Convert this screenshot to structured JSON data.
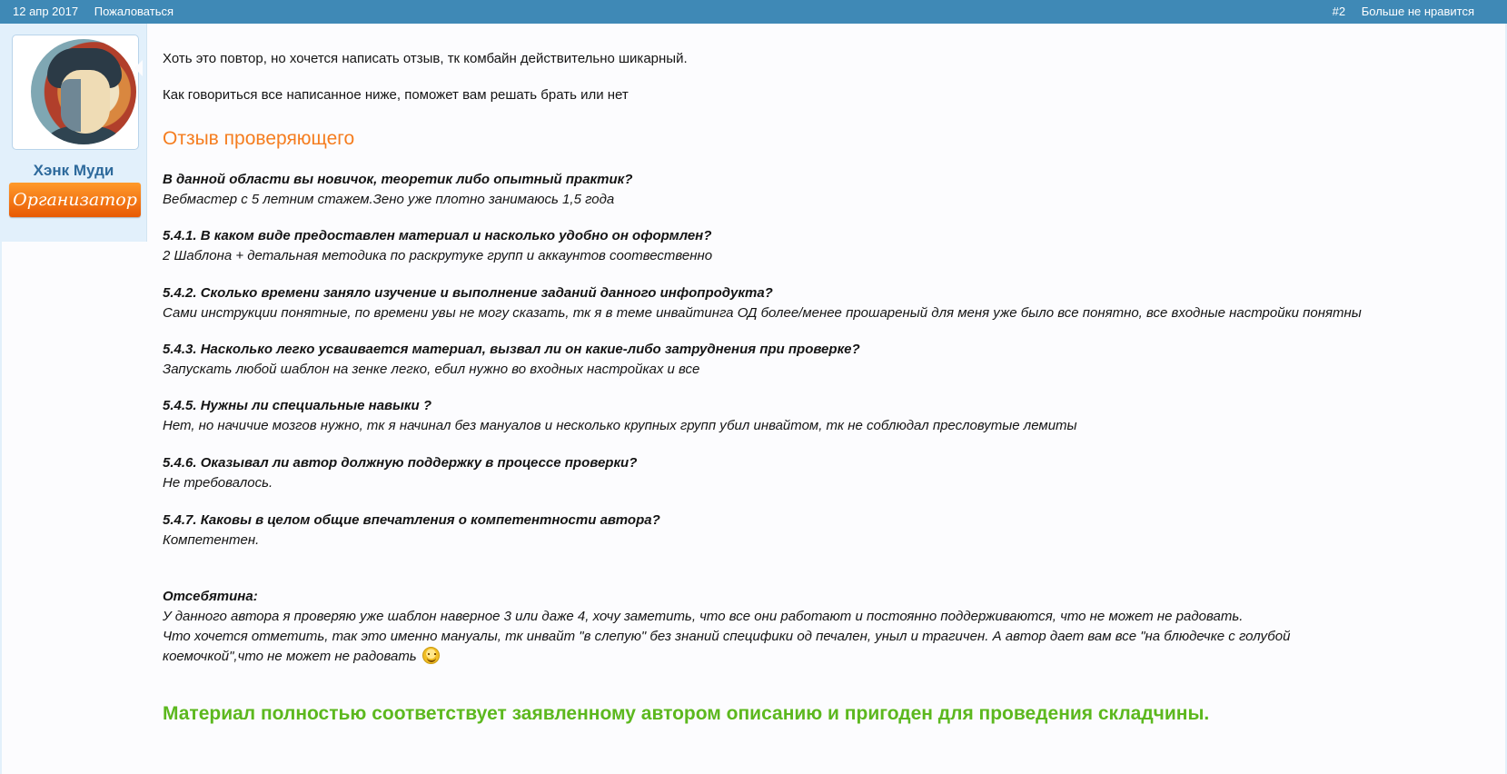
{
  "topbar": {
    "date": "12 апр 2017",
    "report_link": "Пожаловаться",
    "post_number": "#2",
    "unlike_link": "Больше не нравится"
  },
  "author": {
    "name": "Хэнк Муди",
    "role": "Организатор"
  },
  "post": {
    "intro1": "Хоть это повтор, но хочется написать отзыв, тк комбайн действительно шикарный.",
    "intro2": "Как говориться все написанное ниже, поможет вам решать брать или нет",
    "review_heading": "Отзыв проверяющего",
    "qa": [
      {
        "q": "В данной области вы новичок, теоретик либо опытный практик?",
        "a": "Вебмастер с 5 летним стажем.Зено уже плотно занимаюсь 1,5 года"
      },
      {
        "q": "5.4.1. В каком виде предоставлен материал и насколько удобно он оформлен?",
        "a": "2 Шаблона + детальная методика по раскрутуке групп и аккаунтов соотвественно"
      },
      {
        "q": "5.4.2. Сколько времени заняло изучение и выполнение заданий данного инфопродукта?",
        "a": "Сами инструкции понятные, по времени увы не могу сказать, тк я в теме инвайтинга ОД более/менее прошареный для меня уже было все понятно, все входные настройки понятны"
      },
      {
        "q": "5.4.3. Насколько легко усваивается материал, вызвал ли он какие-либо затруднения при проверке?",
        "a": "Запускать любой шаблон на зенке легко, ебил нужно во входных настройках и все"
      },
      {
        "q": "5.4.5. Нужны ли специальные навыки ?",
        "a": "Нет, но начичие мозгов нужно, тк я начинал без мануалов и несколько крупных групп убил инвайтом, тк не соблюдал пресловутые лемиты"
      },
      {
        "q": "5.4.6. Оказывал ли автор должную поддержку в процессе проверки?",
        "a": "Не требовалось."
      },
      {
        "q": "5.4.7. Каковы в целом общие впечатления о компетентности автора?",
        "a": "Компетентен."
      }
    ],
    "notes_heading": "Отсебятина:",
    "notes_line1": "У данного автора я проверяю уже шаблон наверное 3 или даже 4, хочу заметить, что все они работают и постоянно поддерживаются, что не может не радовать.",
    "notes_line2": "Что хочется отметить, так это именно мануалы, тк инвайт \"в слепую\" без знаний специфики од печален, уныл и трагичен. А автор дает вам все \"на блюдечке с голубой",
    "notes_line3": "коемочкой\",что не может не радовать",
    "final": "Материал полностью соответствует заявленному автором описанию и пригоден для проведения складчины."
  }
}
